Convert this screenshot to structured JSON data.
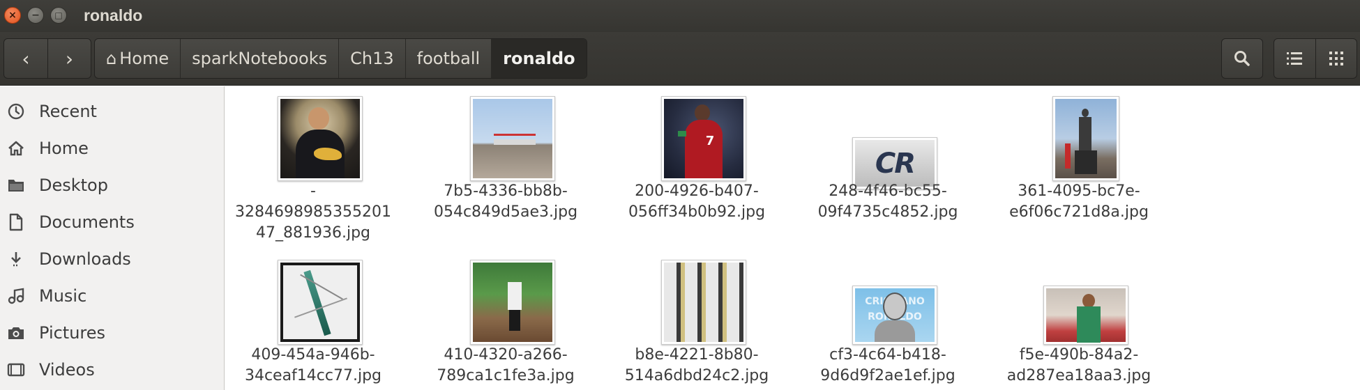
{
  "window": {
    "title": "ronaldo",
    "close_glyph": "×",
    "minimize_glyph": "−",
    "maximize_glyph": "□"
  },
  "toolbar": {
    "back_glyph": "‹",
    "forward_glyph": "›",
    "home_glyph": "⌂",
    "breadcrumb": [
      "Home",
      "sparkNotebooks",
      "Ch13",
      "football",
      "ronaldo"
    ],
    "search_icon": "search-icon",
    "list_view_icon": "list-view-icon",
    "grid_view_icon": "grid-view-icon"
  },
  "sidebar": {
    "items": [
      {
        "label": "Recent",
        "icon": "clock-icon"
      },
      {
        "label": "Home",
        "icon": "home-icon"
      },
      {
        "label": "Desktop",
        "icon": "folder-icon"
      },
      {
        "label": "Documents",
        "icon": "document-icon"
      },
      {
        "label": "Downloads",
        "icon": "download-icon"
      },
      {
        "label": "Music",
        "icon": "music-icon"
      },
      {
        "label": "Pictures",
        "icon": "camera-icon"
      },
      {
        "label": "Videos",
        "icon": "video-icon"
      }
    ]
  },
  "files": [
    {
      "name": "-\n3284698985355201\n47_881936.jpg"
    },
    {
      "name": "7b5-4336-bb8b-\n054c849d5ae3.jpg"
    },
    {
      "name": "200-4926-b407-\n056ff34b0b92.jpg"
    },
    {
      "name": "248-4f46-bc55-\n09f4735c4852.jpg"
    },
    {
      "name": "361-4095-bc7e-\ne6f06c721d8a.jpg"
    },
    {
      "name": "409-454a-946b-\n34ceaf14cc77.jpg"
    },
    {
      "name": "410-4320-a266-\n789ca1c1fe3a.jpg"
    },
    {
      "name": "b8e-4221-8b80-\n514a6dbd24c2.jpg"
    },
    {
      "name": "cf3-4c64-b418-\n9d6d9f2ae1ef.jpg"
    },
    {
      "name": "f5e-490b-84a2-\nad287ea18aa3.jpg"
    }
  ],
  "thumb_text": {
    "logo": "CR",
    "poster": "CRISTIANO\nRONALDO",
    "shirt_number": "7"
  },
  "colors": {
    "titlebar": "#3c3b37",
    "sidebar": "#f2f1f0",
    "close_button": "#e95420"
  }
}
